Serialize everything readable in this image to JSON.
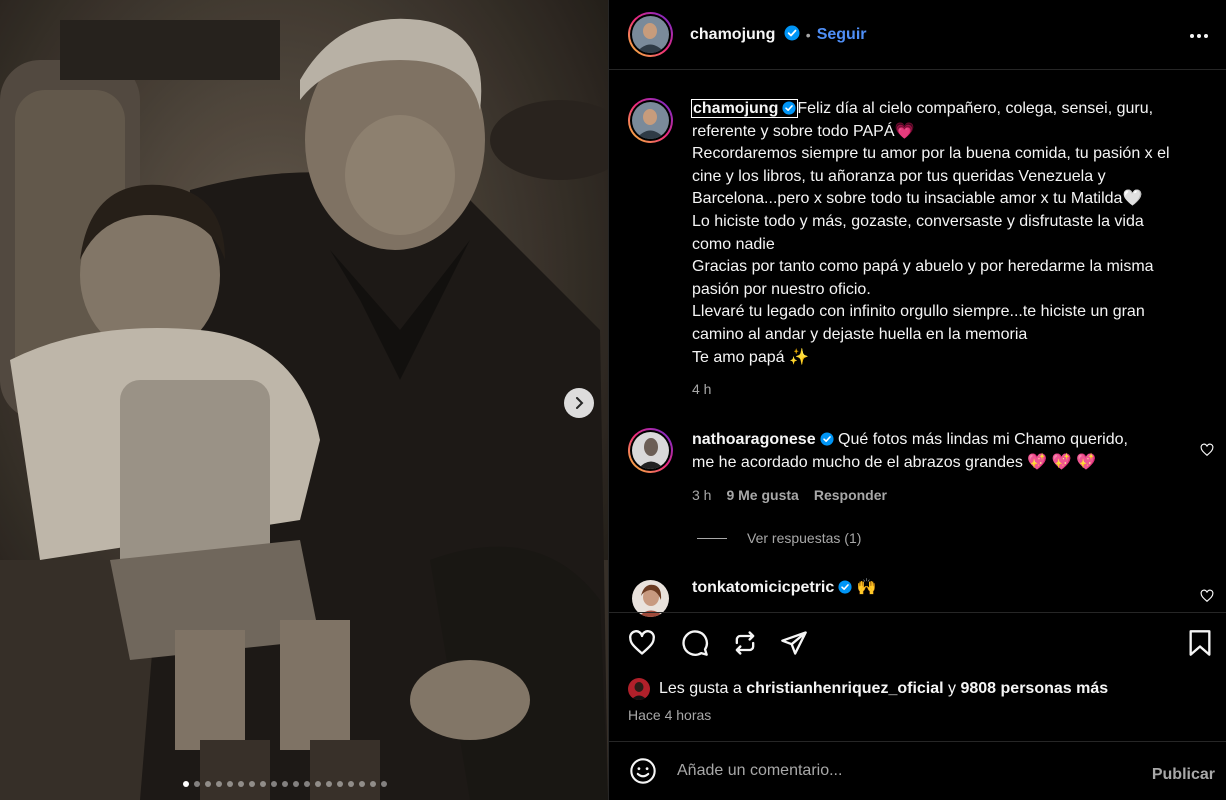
{
  "post": {
    "author": "chamojung",
    "follow_label": "Seguir",
    "more_icon": "more-horizontal-icon",
    "caption_lines": [
      "Feliz día al cielo compañero, colega, sensei, guru,",
      "referente y sobre todo PAPÁ💗",
      "Recordaremos siempre tu amor por la buena comida, tu pasión x el",
      "cine y los libros, tu añoranza por tus queridas Venezuela y",
      "Barcelona...pero x sobre todo tu insaciable amor x tu Matilda🤍",
      "Lo hiciste todo y más, gozaste, conversaste y disfrutaste la vida",
      "como nadie",
      "Gracias por tanto como papá y abuelo y por heredarme la misma",
      "pasión por nuestro oficio.",
      "Llevaré tu legado con infinito orgullo siempre...te hiciste un gran",
      "camino al andar y dejaste huella en la memoria",
      "Te amo papá ✨"
    ],
    "caption_time": "4 h",
    "carousel_dot_count": 19,
    "carousel_active_index": 0
  },
  "comments": [
    {
      "user": "nathoaragonese",
      "text_line1": "Qué fotos más lindas mi Chamo querido,",
      "text_line2": "me he acordado mucho de el abrazos grandes 💖 💖 💖",
      "time": "3 h",
      "likes": "9 Me gusta",
      "reply_label": "Responder",
      "view_replies": "Ver respuestas (1)"
    },
    {
      "user": "tonkatomicicpetric",
      "text": "🙌"
    }
  ],
  "likes": {
    "prefix": "Les gusta a",
    "user": "christianhenriquez_oficial",
    "and": "y",
    "others": "9808 personas más"
  },
  "posted_ago": "Hace 4 horas",
  "add_comment": {
    "placeholder": "Añade un comentario...",
    "publish_label": "Publicar"
  },
  "colors": {
    "background": "#000000",
    "text": "#f5f5f5",
    "secondary": "#a8a8a8",
    "link": "#4f8ff7",
    "verified": "#0095f6"
  }
}
